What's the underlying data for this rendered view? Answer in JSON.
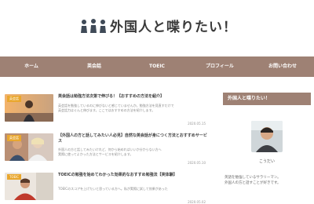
{
  "header": {
    "logo_icon": "people-group-icon",
    "site_title": "外国人と喋りたい！"
  },
  "nav": {
    "items": [
      {
        "label": "ホーム"
      },
      {
        "label": "英会話"
      },
      {
        "label": "TOEIC"
      },
      {
        "label": "プロフィール"
      },
      {
        "label": "お問い合わせ"
      }
    ]
  },
  "posts": [
    {
      "category": "英会話",
      "title": "英会話は勉強方法次第で伸びる！【おすすめの方法を紹介】",
      "excerpt_1": "英会話を勉強しているのに伸びないと感じていませんか。勉強方法を見直すだけで",
      "excerpt_2": "英会話力はぐんと伸びます。ここではおすすめの方法を紹介します。",
      "date": "2020.05.15"
    },
    {
      "category": "英会話",
      "title": "【外国人の方と話してみたい人必見】自然な英会話が身につく方法とおすすめサービス",
      "excerpt_1": "外国人の方と話してみたいけれど、何から始めればいいか分からない方へ",
      "excerpt_2": "実際に使ってよかった方法とサービスを紹介します。",
      "date": "2020.05.10"
    },
    {
      "category": "TOEIC",
      "title": "TOEICの勉強を始めてわかった効果的なおすすめ勉強法【実体験】",
      "excerpt_1": "TOEICのスコアを上げたいと思っている方へ。私が実際に試して効果があった",
      "excerpt_2": "",
      "date": "2020.05.02"
    }
  ],
  "sidebar": {
    "widget_title": "外国人と喋りたい！",
    "profile_name": "こうだい",
    "bio_1": "英語を勉強しているサラリーマン。",
    "bio_2": "外国人の方と話すことが好きです。"
  },
  "colors": {
    "accent": "#9e8174",
    "category_badge": "#e9a72e"
  }
}
